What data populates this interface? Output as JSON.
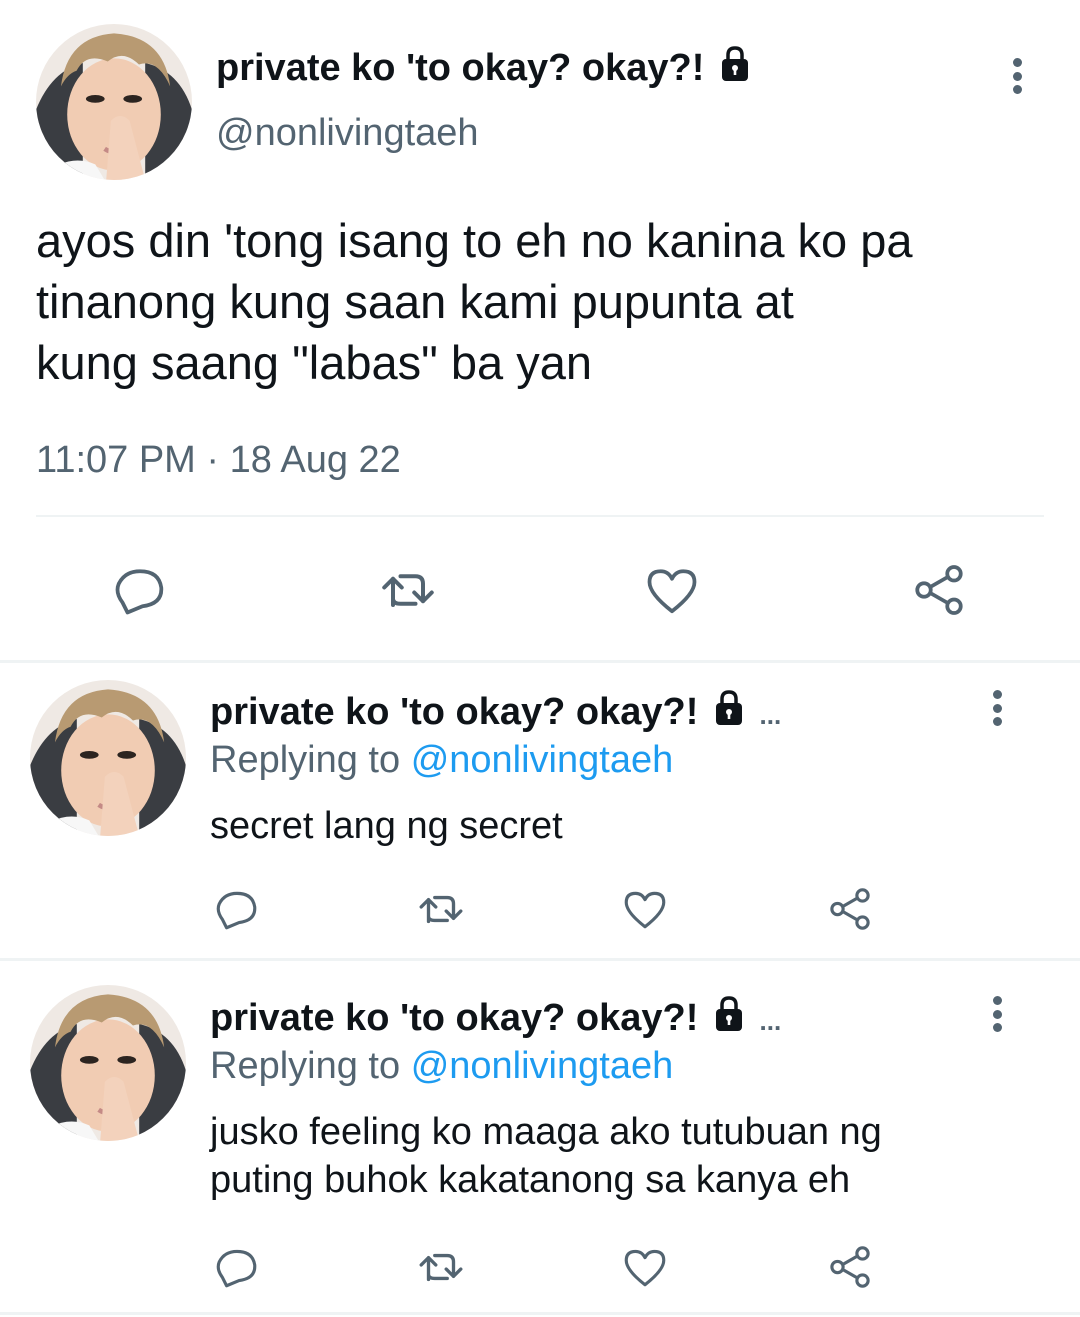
{
  "main_tweet": {
    "display_name": "private ko 'to okay? okay?!",
    "handle": "@nonlivingtaeh",
    "text_lines": [
      "ayos din 'tong isang to eh no kanina ko pa",
      "tinanong kung saan kami pupunta at",
      "kung saang \"labas\" ba yan"
    ],
    "time": "11:07 PM",
    "separator": "·",
    "date": "18 Aug 22"
  },
  "replies": [
    {
      "display_name": "private ko 'to okay? okay?!",
      "truncation": "...",
      "replying_prefix": "Replying to",
      "replying_handle": "@nonlivingtaeh",
      "text_lines": [
        "secret lang ng secret"
      ]
    },
    {
      "display_name": "private ko 'to okay? okay?!",
      "truncation": "...",
      "replying_prefix": "Replying to",
      "replying_handle": "@nonlivingtaeh",
      "text_lines": [
        "jusko feeling ko maaga ako tutubuan ng",
        "puting buhok kakatanong sa kanya eh"
      ]
    }
  ],
  "icons": {
    "actions": [
      "reply-icon",
      "retweet-icon",
      "like-icon",
      "share-icon"
    ],
    "lock": "lock-icon",
    "more": "more-options-icon"
  },
  "colors": {
    "text": "#0f1419",
    "secondary": "#536471",
    "link": "#1d9bf0",
    "divider": "#eff3f4"
  }
}
